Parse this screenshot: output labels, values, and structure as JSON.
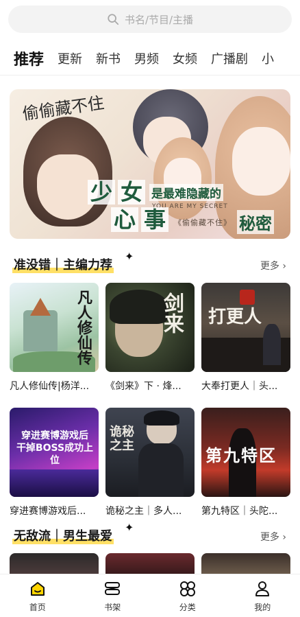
{
  "search": {
    "placeholder": "书名/节目/主播"
  },
  "tabs": [
    {
      "label": "推荐",
      "active": true
    },
    {
      "label": "更新",
      "active": false
    },
    {
      "label": "新书",
      "active": false
    },
    {
      "label": "男频",
      "active": false
    },
    {
      "label": "女频",
      "active": false
    },
    {
      "label": "广播剧",
      "active": false
    },
    {
      "label": "小",
      "active": false
    }
  ],
  "banner": {
    "corner_title": "偷偷藏不住",
    "title_chars": [
      "少",
      "女",
      "心",
      "事"
    ],
    "phrase": "是最难隐藏的",
    "secret": "秘密",
    "english": "YOU ARE MY SECRET",
    "book": "《偷偷藏不住》"
  },
  "sections": [
    {
      "title": "准没错｜主编力荐",
      "more": "更多 ›",
      "items": [
        {
          "caption": "凡人修仙传|杨洋...",
          "cover_text": "凡人修仙传"
        },
        {
          "caption": "《剑来》下 · 烽...",
          "cover_text": "剑来"
        },
        {
          "caption": "大奉打更人｜头...",
          "cover_text": "打更人"
        },
        {
          "caption": "穿进赛博游戏后...",
          "cover_text": "穿进赛博游戏后 干掉BOSS成功上位"
        },
        {
          "caption": "诡秘之主｜多人...",
          "cover_text": "诡秘之主"
        },
        {
          "caption": "第九特区｜头陀...",
          "cover_text": "第九特区"
        }
      ]
    },
    {
      "title": "无敌流｜男生最爱",
      "more": "更多 ›"
    }
  ],
  "bottom_nav": [
    {
      "label": "首页",
      "icon": "home-icon",
      "active": true
    },
    {
      "label": "书架",
      "icon": "bookshelf-icon",
      "active": false
    },
    {
      "label": "分类",
      "icon": "category-icon",
      "active": false
    },
    {
      "label": "我的",
      "icon": "profile-icon",
      "active": false
    }
  ],
  "colors": {
    "accent": "#ffd400",
    "highlight": "#ffe066",
    "text": "#222222"
  }
}
